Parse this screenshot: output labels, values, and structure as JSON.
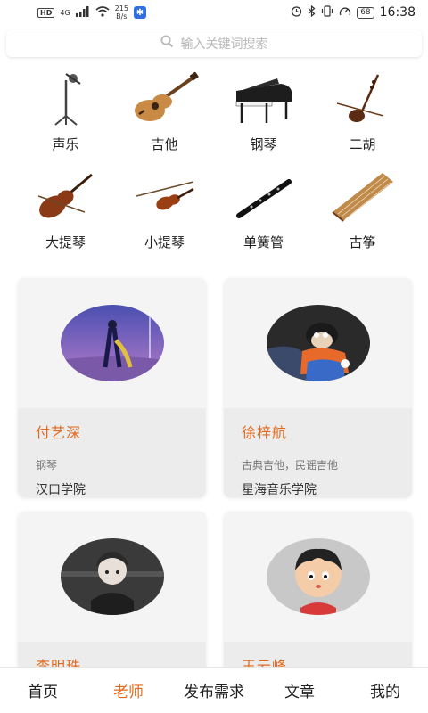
{
  "status_bar": {
    "hd": "HD",
    "network": "4G",
    "speed_value": "215",
    "speed_unit": "B/s",
    "battery": "68",
    "time": "16:38"
  },
  "search": {
    "icon": "search-icon",
    "placeholder": "输入关键词搜索"
  },
  "categories": [
    {
      "label": "声乐",
      "icon": "microphone-icon"
    },
    {
      "label": "吉他",
      "icon": "guitar-icon"
    },
    {
      "label": "钢琴",
      "icon": "piano-icon"
    },
    {
      "label": "二胡",
      "icon": "erhu-icon"
    },
    {
      "label": "大提琴",
      "icon": "cello-icon"
    },
    {
      "label": "小提琴",
      "icon": "violin-icon"
    },
    {
      "label": "单簧管",
      "icon": "clarinet-icon"
    },
    {
      "label": "古筝",
      "icon": "guzheng-icon"
    }
  ],
  "teachers": [
    {
      "name": "付艺深",
      "subject": "钢琴",
      "school": "汉口学院"
    },
    {
      "name": "徐梓航",
      "subject": "古典吉他，民谣吉他",
      "school": "星海音乐学院"
    },
    {
      "name": "李明珠",
      "subject": "",
      "school": ""
    },
    {
      "name": "王云峰",
      "subject": "",
      "school": ""
    }
  ],
  "tab_bar": {
    "tabs": [
      {
        "label": "首页",
        "active": false
      },
      {
        "label": "老师",
        "active": true
      },
      {
        "label": "发布需求",
        "active": false
      },
      {
        "label": "文章",
        "active": false
      },
      {
        "label": "我的",
        "active": false
      }
    ]
  },
  "colors": {
    "accent": "#e06a1e",
    "card_bg": "#f4f4f4",
    "placeholder": "#b8b8b8"
  }
}
